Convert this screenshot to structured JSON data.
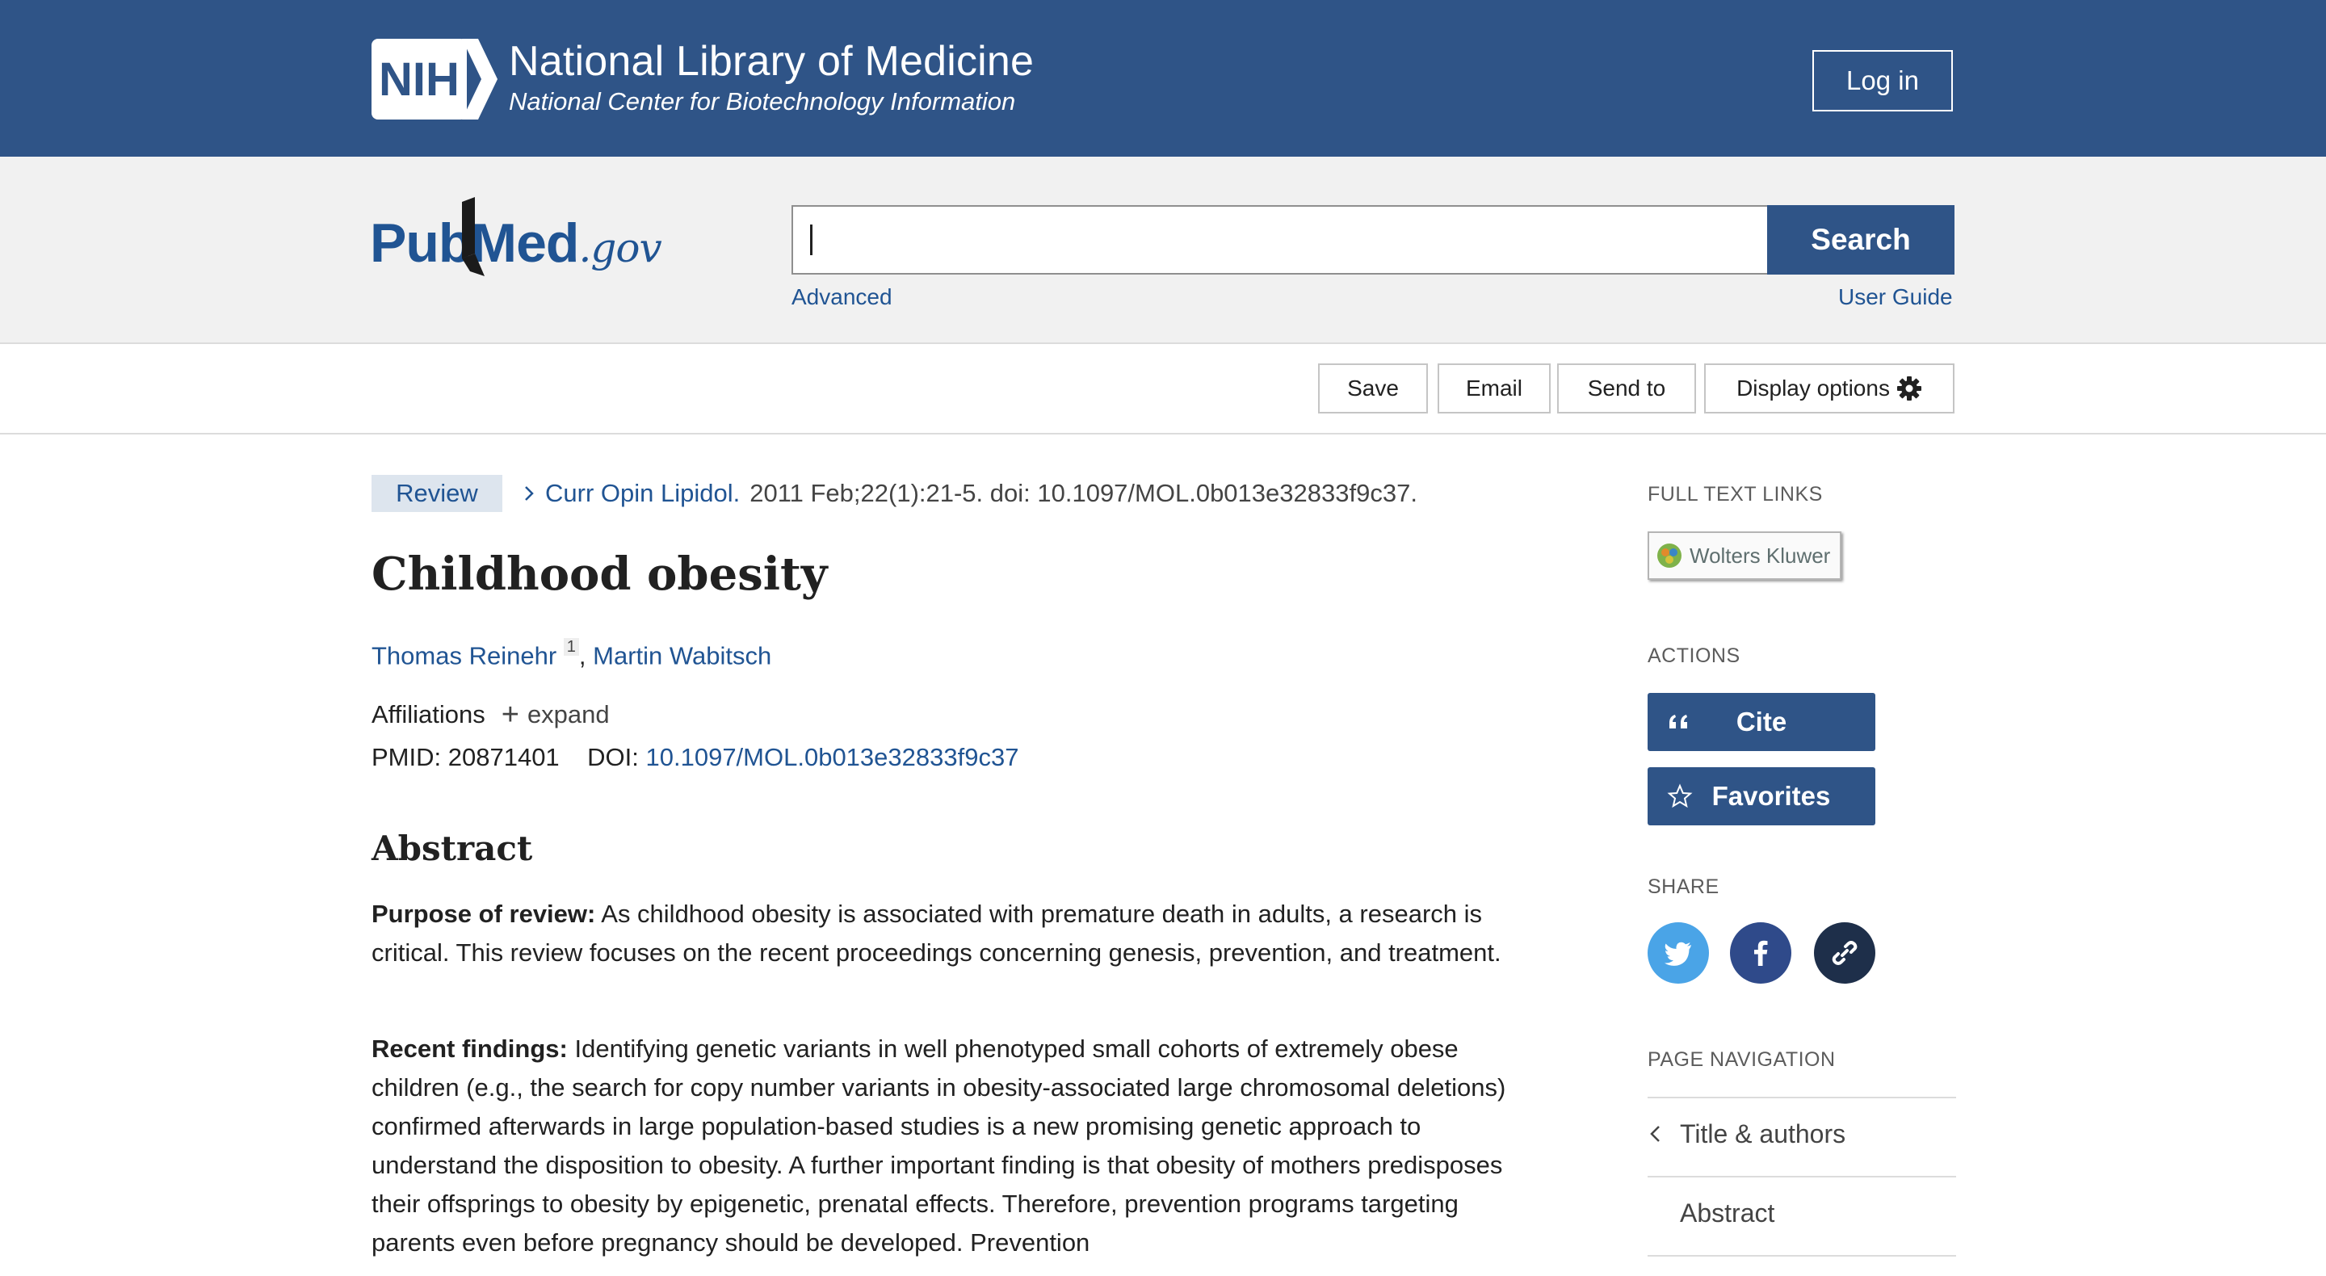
{
  "nih_header": {
    "logo_text": "NIH",
    "title": "National Library of Medicine",
    "subtitle": "National Center for Biotechnology Information",
    "login_label": "Log in"
  },
  "search": {
    "logo_main": "PubMed",
    "logo_suffix": ".gov",
    "query_value": "",
    "search_label": "Search",
    "advanced_label": "Advanced",
    "user_guide_label": "User Guide"
  },
  "toolbar": {
    "save_label": "Save",
    "email_label": "Email",
    "send_to_label": "Send to",
    "display_options_label": "Display options"
  },
  "article": {
    "type_tag": "Review",
    "journal": "Curr Opin Lipidol.",
    "citation_rest": "2011 Feb;22(1):21-5. doi: 10.1097/MOL.0b013e32833f9c37.",
    "title": "Childhood obesity",
    "authors": [
      {
        "name": "Thomas Reinehr",
        "affil_ref": "1"
      },
      {
        "name": "Martin Wabitsch"
      }
    ],
    "author_separator": ", ",
    "affiliations_label": "Affiliations",
    "expand_symbol": "+",
    "expand_label": "expand",
    "pmid_label": "PMID:",
    "pmid": "20871401",
    "doi_label": "DOI:",
    "doi": "10.1097/MOL.0b013e32833f9c37"
  },
  "abstract": {
    "heading": "Abstract",
    "sections": [
      {
        "label": "Purpose of review:",
        "text": "As childhood obesity is associated with premature death in adults, a research is critical. This review focuses on the recent proceedings concerning genesis, prevention, and treatment."
      },
      {
        "label": "Recent findings:",
        "text": "Identifying genetic variants in well phenotyped small cohorts of extremely obese children (e.g., the search for copy number variants in obesity-associated large chromosomal deletions) confirmed afterwards in large population-based studies is a new promising genetic approach to understand the disposition to obesity. A further important finding is that obesity of mothers predisposes their offsprings to obesity by epigenetic, prenatal effects. Therefore, prevention programs targeting parents even before pregnancy should be developed. Prevention"
      }
    ]
  },
  "sidebar": {
    "full_text_heading": "FULL TEXT LINKS",
    "full_text_provider": "Wolters Kluwer",
    "actions_heading": "ACTIONS",
    "cite_label": "Cite",
    "favorites_label": "Favorites",
    "share_heading": "SHARE",
    "share_colors": {
      "twitter": "#4aa4e7",
      "facebook": "#2f4a8a",
      "link": "#1e2f4a"
    },
    "page_nav_heading": "PAGE NAVIGATION",
    "page_nav_items": [
      "Title & authors",
      "Abstract"
    ]
  },
  "colors": {
    "nih_blue": "#2f5487",
    "link_blue": "#205493",
    "search_band": "#f1f1f1"
  }
}
